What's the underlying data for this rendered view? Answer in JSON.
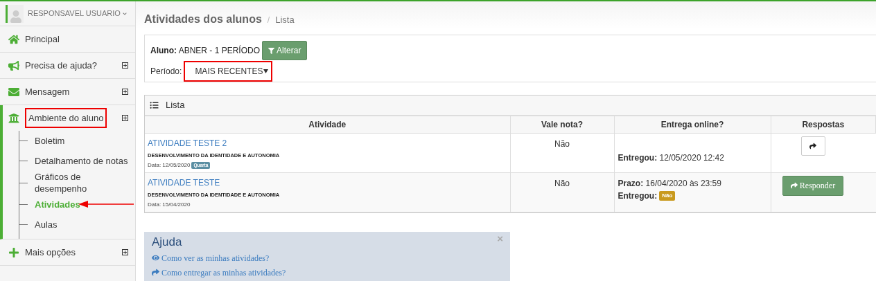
{
  "user": {
    "name": "RESPONSAVEL USUARIO"
  },
  "sidebar": {
    "items": [
      {
        "label": "Principal",
        "kind": "home",
        "expandable": false,
        "expanded": false,
        "outlined": false
      },
      {
        "label": "Precisa de ajuda?",
        "kind": "megaphone",
        "expandable": true,
        "expanded": false,
        "outlined": false
      },
      {
        "label": "Mensagem",
        "kind": "envelope",
        "expandable": true,
        "expanded": false,
        "outlined": false
      },
      {
        "label": "Ambiente do aluno",
        "kind": "bank",
        "expandable": true,
        "expanded": true,
        "outlined": true,
        "children": [
          {
            "label": "Boletim",
            "selected": false,
            "pointed": false
          },
          {
            "label": "Detalhamento de notas",
            "selected": false,
            "pointed": false
          },
          {
            "label": "Gráficos de desempenho",
            "selected": false,
            "pointed": false
          },
          {
            "label": "Atividades",
            "selected": true,
            "pointed": true
          },
          {
            "label": "Aulas",
            "selected": false,
            "pointed": false
          }
        ]
      },
      {
        "label": "Mais opções",
        "kind": "plus",
        "expandable": true,
        "expanded": false,
        "outlined": false
      }
    ]
  },
  "breadcrumb": {
    "title": "Atividades dos alunos",
    "separator": "/",
    "current": "Lista"
  },
  "filter": {
    "student_label": "Aluno:",
    "student": "ABNER - 1 PERÍODO",
    "change_button": "Alterar",
    "period_label": "Período:",
    "period": "MAIS RECENTES",
    "period_outlined": true
  },
  "list": {
    "title": "Lista",
    "columns": [
      "Atividade",
      "Vale nota?",
      "Entrega online?",
      "Respostas"
    ],
    "rows": [
      {
        "title": "ATIVIDADE TESTE 2",
        "subject": "DESENVOLVIMENTO DA IDENTIDADE E AUTONOMIA",
        "date": "Data: 12/05/2020",
        "day_badge": "Quarta",
        "grade": "Não",
        "deadline_label": null,
        "deadline": null,
        "delivered_label": "Entregou:",
        "delivered": "12/05/2020 12:42",
        "delivered_badge": null,
        "action": {
          "kind": "icon"
        }
      },
      {
        "title": "ATIVIDADE TESTE",
        "subject": "DESENVOLVIMENTO DA IDENTIDADE E AUTONOMIA",
        "date": "Data: 15/04/2020",
        "day_badge": null,
        "grade": "Não",
        "deadline_label": "Prazo:",
        "deadline": "16/04/2020 às 23:59",
        "delivered_label": "Entregou:",
        "delivered": null,
        "delivered_badge": "Não",
        "action": {
          "kind": "button",
          "label": "Responder"
        }
      }
    ]
  },
  "help": {
    "title": "Ajuda",
    "close": "×",
    "links": [
      {
        "kind": "eye",
        "label": "Como ver as minhas atividades?"
      },
      {
        "kind": "share",
        "label": "Como entregar as minhas atividades?"
      }
    ]
  }
}
